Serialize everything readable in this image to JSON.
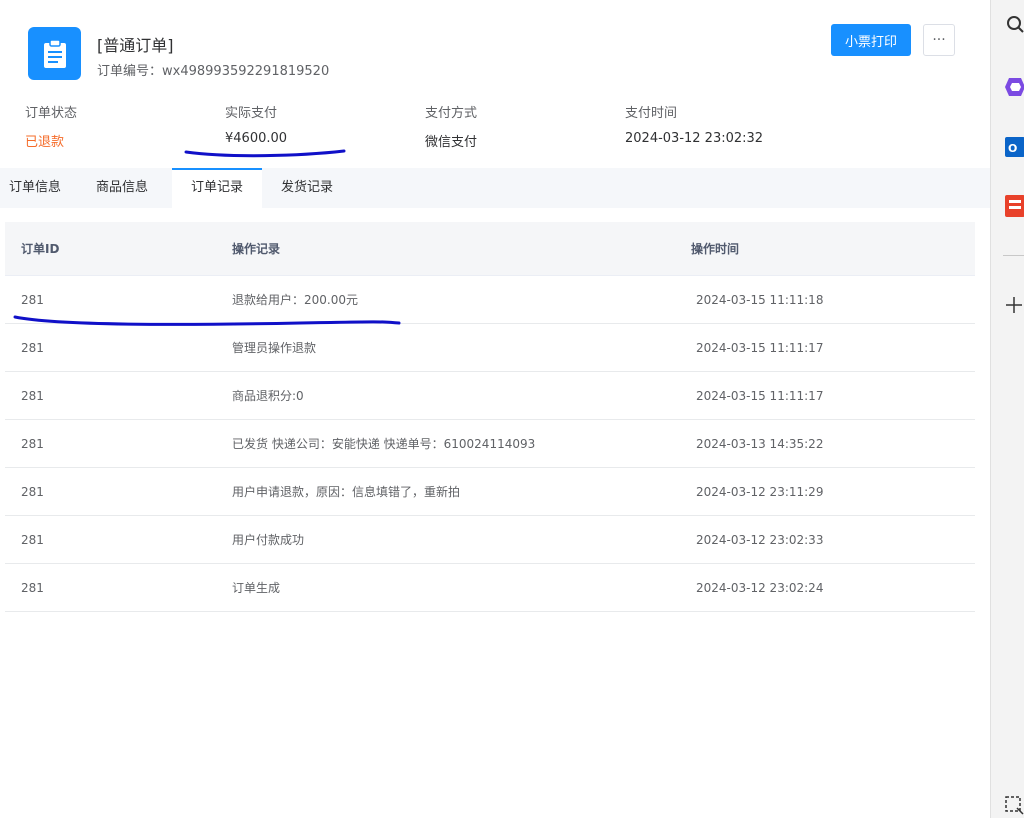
{
  "header": {
    "title": "[普通订单]",
    "order_no_label": "订单编号：",
    "order_no": "wx498993592291819520",
    "print_button": "小票打印",
    "more_button": "···"
  },
  "summary": [
    {
      "label": "订单状态",
      "value": "已退款",
      "highlight": true
    },
    {
      "label": "实际支付",
      "value": "¥4600.00",
      "highlight": false
    },
    {
      "label": "支付方式",
      "value": "微信支付",
      "highlight": false
    },
    {
      "label": "支付时间",
      "value": "2024-03-12 23:02:32",
      "highlight": false
    }
  ],
  "tabs": [
    {
      "label": "订单信息",
      "active": false
    },
    {
      "label": "商品信息",
      "active": false
    },
    {
      "label": "订单记录",
      "active": true
    },
    {
      "label": "发货记录",
      "active": false
    }
  ],
  "table": {
    "columns": [
      "订单ID",
      "操作记录",
      "操作时间"
    ],
    "rows": [
      {
        "id": "281",
        "record": "退款给用户：200.00元",
        "time": "2024-03-15 11:11:18"
      },
      {
        "id": "281",
        "record": "管理员操作退款",
        "time": "2024-03-15 11:11:17"
      },
      {
        "id": "281",
        "record": "商品退积分:0",
        "time": "2024-03-15 11:11:17"
      },
      {
        "id": "281",
        "record": "已发货 快递公司：安能快递 快递单号：610024114093",
        "time": "2024-03-13 14:35:22"
      },
      {
        "id": "281",
        "record": "用户申请退款，原因：信息填错了，重新拍",
        "time": "2024-03-12 23:11:29"
      },
      {
        "id": "281",
        "record": "用户付款成功",
        "time": "2024-03-12 23:02:33"
      },
      {
        "id": "281",
        "record": "订单生成",
        "time": "2024-03-12 23:02:24"
      }
    ]
  },
  "colors": {
    "accent": "#1890ff",
    "status_refunded": "#f56c2a",
    "annotation_ink": "#1010c8"
  },
  "sidebar": {
    "icons": [
      "search-icon",
      "copilot-icon",
      "outlook-icon",
      "office-icon",
      "add-icon",
      "screenshot-icon"
    ]
  }
}
